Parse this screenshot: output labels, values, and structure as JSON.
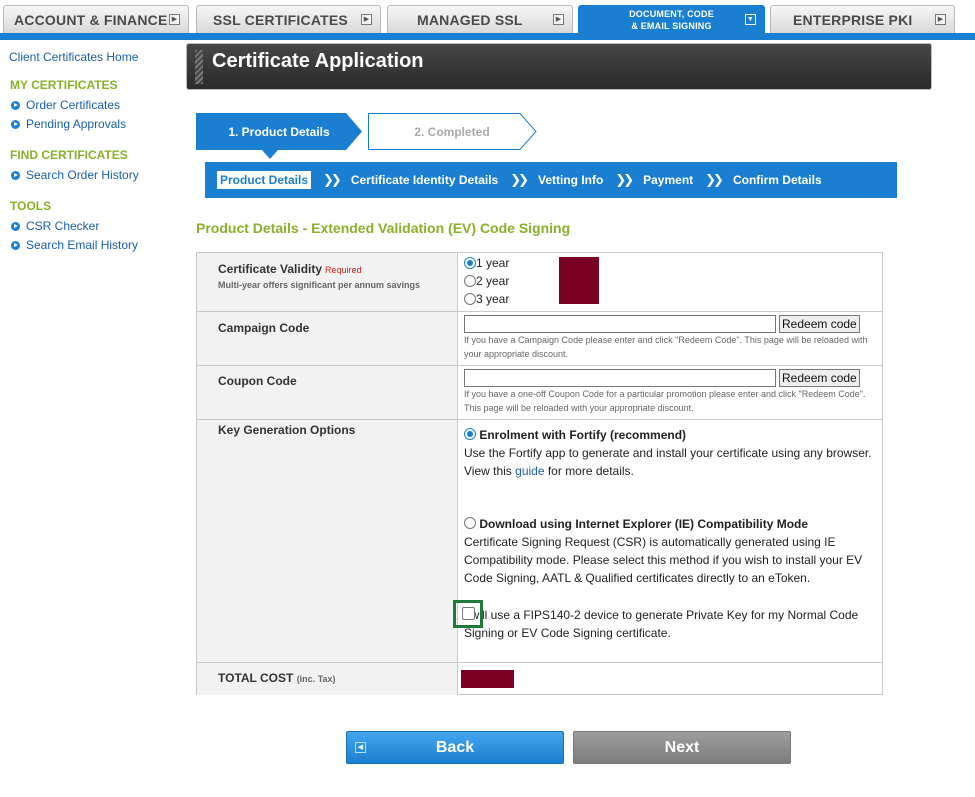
{
  "topnav": {
    "tabs": [
      {
        "label": "ACCOUNT & FINANCE"
      },
      {
        "label": "SSL CERTIFICATES"
      },
      {
        "label": "MANAGED SSL"
      },
      {
        "label_line1": "DOCUMENT, CODE",
        "label_line2": "& EMAIL SIGNING",
        "active": true
      },
      {
        "label": "ENTERPRISE PKI"
      }
    ],
    "accent_color": "#1a7fd0"
  },
  "sidebar": {
    "home": "Client Certificates Home",
    "sections": [
      {
        "heading": "MY CERTIFICATES",
        "items": [
          "Order Certificates",
          "Pending Approvals"
        ]
      },
      {
        "heading": "FIND CERTIFICATES",
        "items": [
          "Search Order History"
        ]
      },
      {
        "heading": "TOOLS",
        "items": [
          "CSR Checker",
          "Search Email History"
        ]
      }
    ]
  },
  "banner": {
    "title": "Certificate Application"
  },
  "steps": [
    {
      "label": "1. Product Details",
      "active": true
    },
    {
      "label": "2. Completed",
      "active": false
    }
  ],
  "substeps": [
    "Product Details",
    "Certificate Identity Details",
    "Vetting Info",
    "Payment",
    "Confirm Details"
  ],
  "section_title": "Product Details  - Extended Validation (EV) Code Signing",
  "form": {
    "validity": {
      "label": "Certificate Validity",
      "required": "Required",
      "note": "Multi-year offers significant per annum savings",
      "options": [
        "1 year",
        "2 year",
        "3 year"
      ],
      "selected": 0
    },
    "campaign": {
      "label": "Campaign Code",
      "value": "",
      "button": "Redeem code",
      "hint": "If you have a Campaign Code please enter and click \"Redeem Code\". This page will be reloaded with your appropriate discount."
    },
    "coupon": {
      "label": "Coupon Code",
      "value": "",
      "button": "Redeem code",
      "hint": "If you have a one-off Coupon Code for a particular promotion please enter and click \"Redeem Code\". This page will be reloaded with your appropriate discount."
    },
    "keygen": {
      "label": "Key Generation Options",
      "opt1_title": "Enrolment with Fortify (recommend)",
      "opt1_desc_before": "Use the Fortify app to generate and install your certificate using any browser. View this ",
      "opt1_link": "guide",
      "opt1_desc_after": " for more details.",
      "opt2_title": "Download using Internet Explorer (IE) Compatibility Mode",
      "opt2_desc": "Certificate Signing Request (CSR) is automatically generated using IE Compatibility mode. Please select this method if you wish to install your EV Code Signing, AATL & Qualified certificates directly to an eToken.",
      "fips_text": "I will use a FIPS140-2 device to generate Private Key for my Normal Code Signing or EV Code Signing certificate.",
      "selected": 0,
      "fips_checked": false
    },
    "total": {
      "label": "TOTAL COST",
      "suffix": "(inc. Tax)"
    }
  },
  "buttons": {
    "back": "Back",
    "next": "Next"
  }
}
